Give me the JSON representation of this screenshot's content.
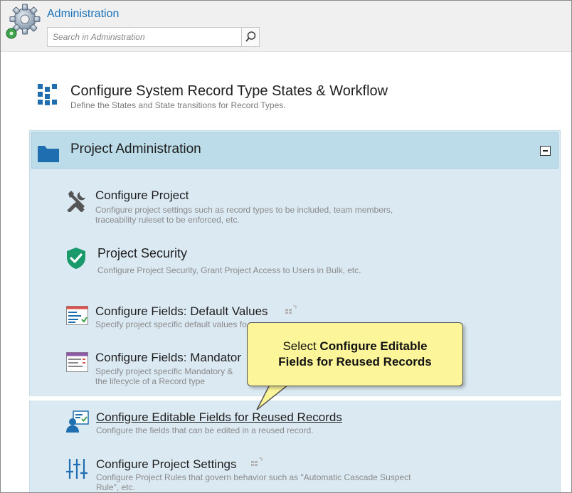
{
  "header": {
    "app_title": "Administration",
    "search_placeholder": "Search in Administration"
  },
  "workflow": {
    "title": "Configure System Record Type States & Workflow",
    "description": "Define the States and State transitions for Record Types.",
    "icon": "grid-blocks-icon"
  },
  "project_admin": {
    "title": "Project Administration",
    "icon": "folder-icon",
    "collapse_icon": "minus-icon",
    "items": [
      {
        "title": "Configure Project",
        "description_line1": "Configure project settings such as record types to be included, team members,",
        "description_line2": "traceability ruleset to be enforced, etc.",
        "icon": "tools-icon"
      },
      {
        "title": "Project Security",
        "description_line1": "Configure Project Security, Grant Project Access to Users in Bulk, etc.",
        "icon": "shield-check-icon"
      },
      {
        "title": "Configure Fields: Default Values",
        "description_line1": "Specify project specific default values fo",
        "icon": "form-defaults-icon"
      },
      {
        "title": "Configure Fields: Mandator",
        "description_line1": "Specify project specific Mandatory &",
        "description_line2": "the lifecycle of a Record type",
        "icon": "form-mandatory-icon"
      },
      {
        "title": "Configure Editable Fields for Reused Records",
        "description_line1": "Configure the fields that can be edited in a reused record.",
        "icon": "user-card-icon"
      },
      {
        "title": "Configure Project Settings",
        "description_line1": "Configure Project Rules that govern behavior such as \"Automatic Cascade Suspect",
        "description_line2": "Rule\", etc.",
        "icon": "sliders-icon"
      }
    ]
  },
  "callout": {
    "prefix": "Select ",
    "bold_line1": "Configure Editable",
    "bold_line2": "Fields for Reused Records"
  },
  "colors": {
    "accent": "#1a73b8",
    "panel_bg": "#dbe9f2",
    "panel_header_bg": "#bcdce9",
    "callout_bg": "#fdf59a",
    "icon_blue": "#1f6fb0",
    "shield_green": "#1a9a6a"
  }
}
